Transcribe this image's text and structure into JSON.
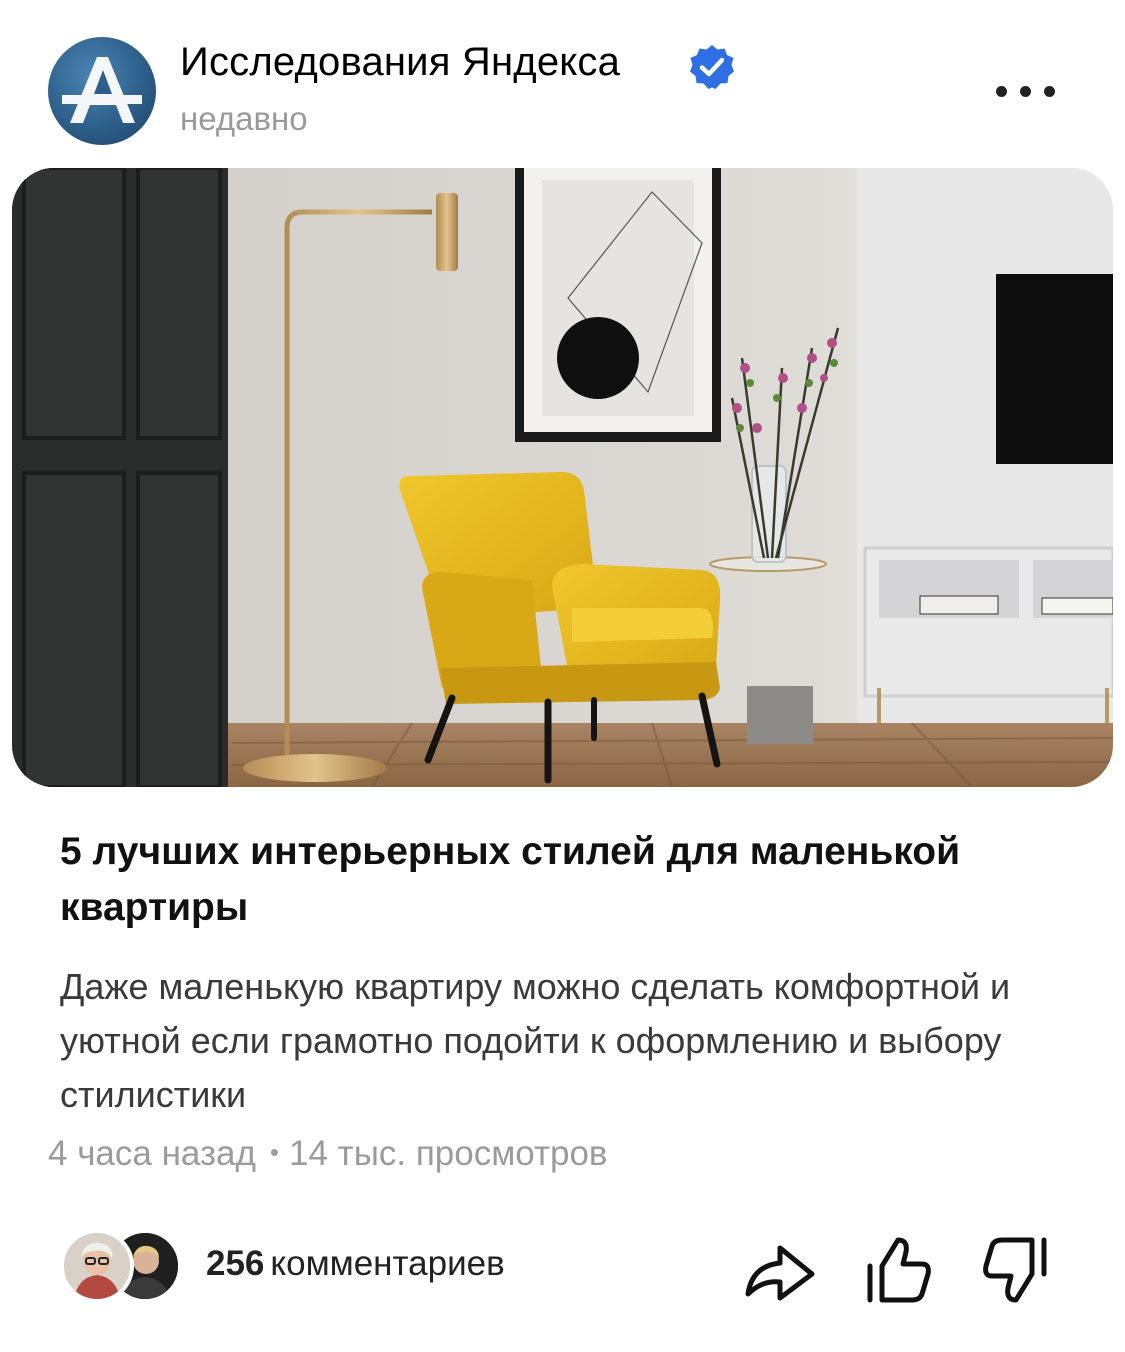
{
  "channel": {
    "name": "Исследования Яндекса",
    "posted": "недавно",
    "verified_icon": "verified-badge-icon",
    "more_icon": "more-dots-icon"
  },
  "article": {
    "image_icon": "article-photo",
    "title": "5 лучших интерьерных стилей для маленькой квартиры",
    "description": "Даже маленькую квартиру можно сделать комфортной и уютной если грамотно подойти к оформлению и выбору стилистики",
    "time_ago": "4 часа назад",
    "separator": "•",
    "views": "14 тыс. просмотров"
  },
  "footer": {
    "comments_count": "256",
    "comments_label": "комментариев",
    "actions": [
      "share-icon",
      "like-icon",
      "dislike-icon"
    ]
  },
  "colors": {
    "accent_blue": "#2f6fe4",
    "chair_yellow": "#e6b820",
    "text_secondary": "#9b9b9b"
  }
}
